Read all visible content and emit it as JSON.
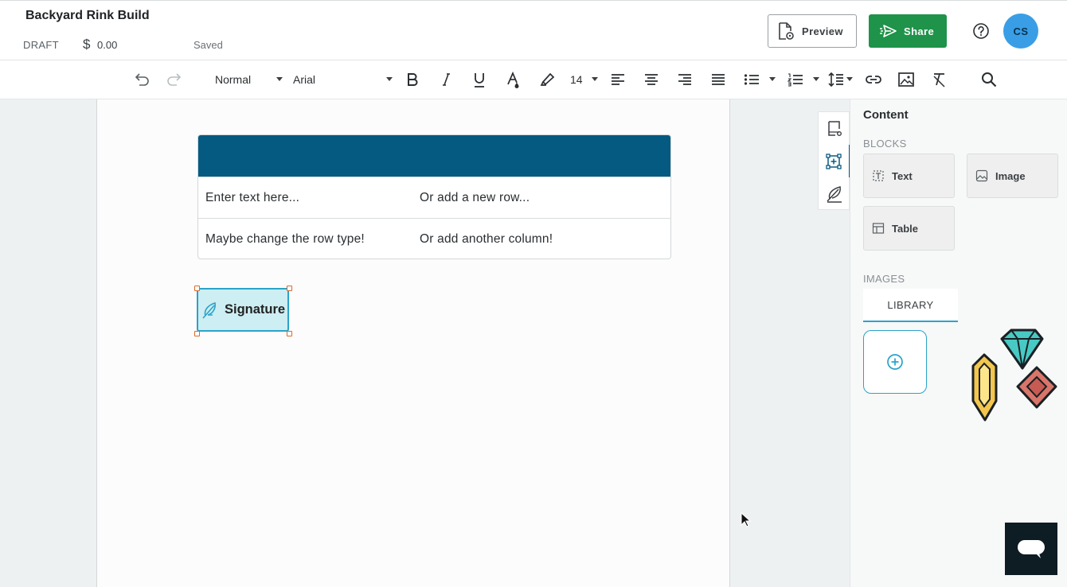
{
  "document": {
    "title": "Backyard Rink Build",
    "status": "DRAFT",
    "currency_symbol": "$",
    "amount": "0.00",
    "save_state": "Saved"
  },
  "header_actions": {
    "preview_label": "Preview",
    "share_label": "Share",
    "avatar_initials": "CS"
  },
  "toolbar": {
    "style_value": "Normal",
    "font_value": "Arial",
    "font_size": "14"
  },
  "content_table": {
    "rows": [
      [
        "Enter text here...",
        "Or add a new row..."
      ],
      [
        "Maybe change the row type!",
        "Or add another column!"
      ]
    ]
  },
  "signature_block": {
    "label": "Signature"
  },
  "panel": {
    "title": "Content",
    "blocks_heading": "BLOCKS",
    "blocks": [
      {
        "label": "Text",
        "icon": "text-block-icon"
      },
      {
        "label": "Image",
        "icon": "image-block-icon"
      },
      {
        "label": "Table",
        "icon": "table-block-icon"
      }
    ],
    "images_heading": "IMAGES",
    "library_tab": "LIBRARY"
  },
  "colors": {
    "table_header": "#045a80",
    "share_button": "#1e9349",
    "avatar": "#3a9ee6",
    "accent": "#2aa3c9"
  }
}
